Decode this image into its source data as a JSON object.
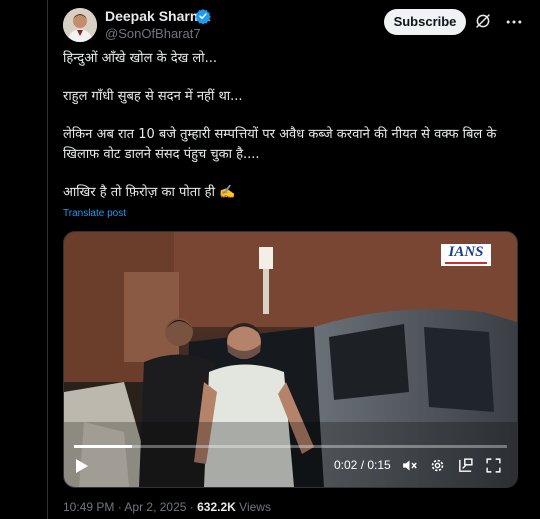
{
  "author": {
    "display_name": "Deepak Sharma",
    "handle": "@SonOfBharat7",
    "verified_color": "#1d9bf0"
  },
  "header": {
    "subscribe_label": "Subscribe"
  },
  "post": {
    "paragraphs": [
      "हिन्दुओं आँखे खोल के देख लो...",
      "राहुल गाँधी सुबह से सदन में नहीं था...",
      "लेकिन अब रात 10 बजे तुम्हारी सम्पत्तियों पर अवैध कब्जे करवाने की नीयत से वक्फ बिल के खिलाफ वोट डालने संसद पंहुच चुका है....",
      "आखिर है तो फ़िरोज़ का पोता ही ✍️"
    ],
    "translate_label": "Translate post"
  },
  "video": {
    "watermark": "IANS",
    "elapsed": "0:02",
    "duration": "0:15",
    "time_separator": " / ",
    "progress_fraction": 0.133
  },
  "meta": {
    "time": "10:49 PM",
    "separator": " · ",
    "date": "Apr 2, 2025",
    "views_count": "632.2K",
    "views_label": "Views"
  },
  "icons": {
    "verified": "verified-badge-icon",
    "grok": "grok-icon",
    "more": "more-icon",
    "play": "play-icon",
    "volume": "volume-icon",
    "settings": "settings-icon",
    "pip": "picture-in-picture-icon",
    "fullscreen": "fullscreen-icon"
  },
  "colors": {
    "background": "#000000",
    "text": "#e7e9ea",
    "muted": "#71767b",
    "accent": "#1d9bf0"
  }
}
